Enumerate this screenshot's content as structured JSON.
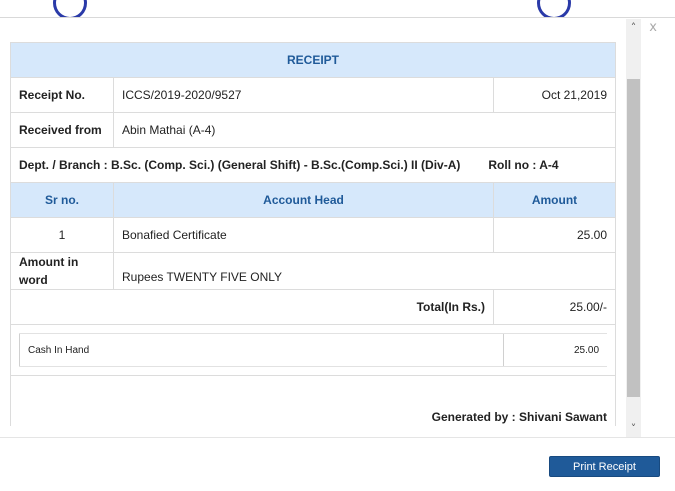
{
  "window": {
    "close_label": "x"
  },
  "receipt": {
    "title": "RECEIPT",
    "receipt_no_label": "Receipt No.",
    "receipt_no": "ICCS/2019-2020/9527",
    "date": "Oct 21,2019",
    "received_from_label": "Received from",
    "received_from": "Abin Mathai (A-4)",
    "dept_line": "Dept. / Branch : B.Sc. (Comp. Sci.) (General Shift) - B.Sc.(Comp.Sci.) II (Div-A)",
    "roll_no": "Roll no : A-4",
    "columns": {
      "sr_no": "Sr no.",
      "account_head": "Account Head",
      "amount": "Amount"
    },
    "items": [
      {
        "sr_no": "1",
        "account_head": "Bonafied Certificate",
        "amount": "25.00"
      }
    ],
    "amount_in_word_label": "Amount in word",
    "amount_in_word": "Rupees TWENTY FIVE ONLY",
    "total_label": "Total(In Rs.)",
    "total": "25.00/-",
    "payment_mode": "Cash In Hand",
    "payment_amount": "25.00",
    "generated_by": "Generated by : Shivani Sawant"
  },
  "footer": {
    "print_button": "Print Receipt"
  },
  "icons": {
    "scroll_up": "chevron-up-icon",
    "scroll_down": "chevron-down-icon",
    "close": "close-icon"
  },
  "colors": {
    "header_bg": "#d6e8fb",
    "header_text": "#1f5a99",
    "button": "#1f5a99"
  }
}
